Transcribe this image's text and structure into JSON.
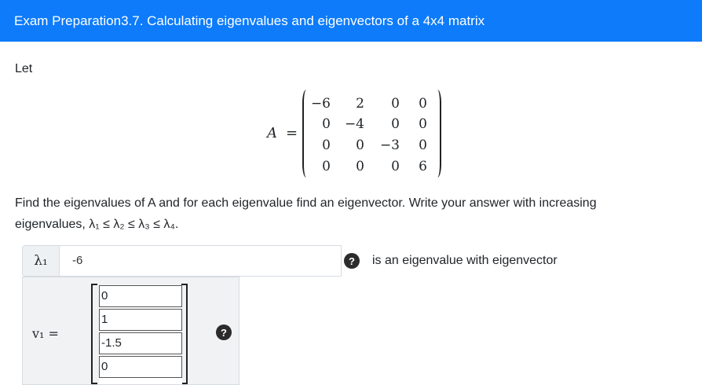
{
  "header": {
    "title": "Exam Preparation3.7. Calculating eigenvalues and eigenvectors of a 4x4 matrix"
  },
  "intro": {
    "let": "Let"
  },
  "matrix": {
    "label": "A",
    "equals": "=",
    "rows": [
      [
        "−6",
        "2",
        "0",
        "0"
      ],
      [
        "0",
        "−4",
        "0",
        "0"
      ],
      [
        "0",
        "0",
        "−3",
        "0"
      ],
      [
        "0",
        "0",
        "0",
        "6"
      ]
    ]
  },
  "prompt": {
    "line1": "Find the eigenvalues of A and for each eigenvalue find an eigenvector. Write your answer with increasing",
    "line2": "eigenvalues, λ₁ ≤ λ₂ ≤ λ₃ ≤ λ₄."
  },
  "answer": {
    "lambda_label": "λ₁",
    "lambda_value": "-6",
    "help_glyph": "?",
    "eigen_text": "is an eigenvalue with eigenvector",
    "vector_label": "v₁ =",
    "vector_values": [
      "0",
      "1",
      "-1.5",
      "0"
    ]
  }
}
